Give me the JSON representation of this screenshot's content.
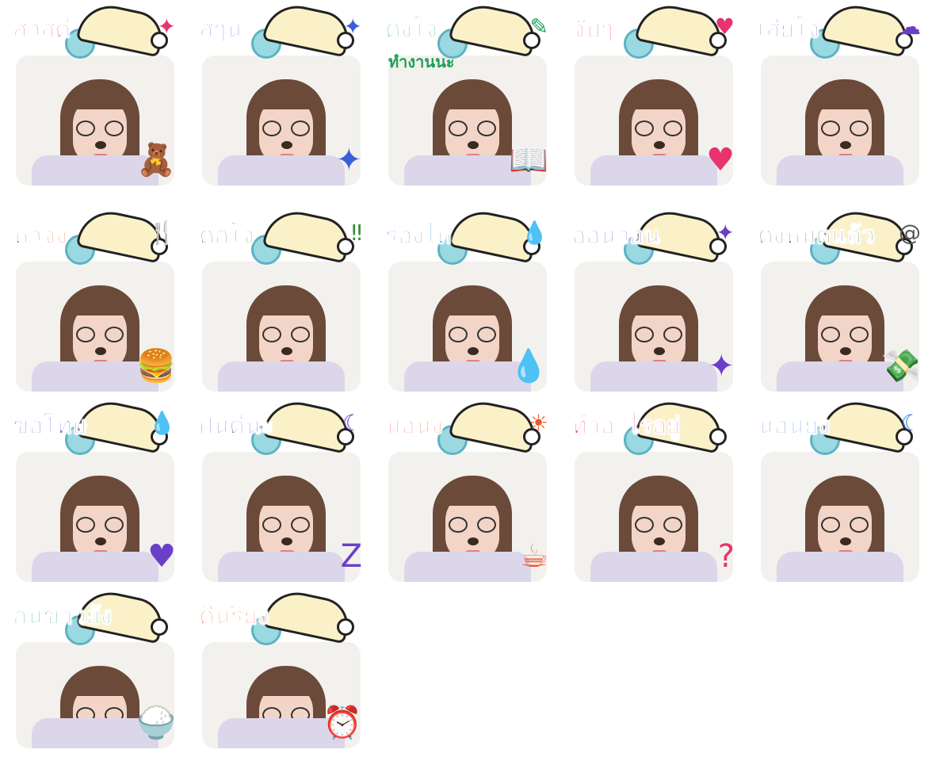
{
  "stickers": [
    {
      "label": "สวัสดี",
      "color": "#e8336f",
      "prop_icon": "teddy-bear",
      "prop": "🧸",
      "deco_icon": "sparkle",
      "deco": "✦"
    },
    {
      "label": "สู้ๆนะ",
      "color": "#3a5fd9",
      "prop_icon": "sparkle",
      "prop": "✦",
      "deco_icon": "sparkle",
      "deco": "✦"
    },
    {
      "label": "ตั้งใจ",
      "sublabel": "ทำงานนะ",
      "color": "#20a058",
      "prop_icon": "open-book",
      "prop": "📖",
      "deco_icon": "pen",
      "deco": "✎"
    },
    {
      "label": "จุ๊บๆ",
      "color": "#e8336f",
      "prop_icon": "heart",
      "prop": "♥",
      "deco_icon": "heart",
      "deco": "♥"
    },
    {
      "label": "เสียใจ",
      "color": "#6a3fc8",
      "prop_icon": "none",
      "prop": "",
      "deco_icon": "rain-cloud",
      "deco": "☁"
    },
    {
      "label": "หิวจัง",
      "color": "#f0572e",
      "prop_icon": "burger",
      "prop": "🍔",
      "deco_icon": "fork",
      "deco": "🍴"
    },
    {
      "label": "ตกใจ",
      "color": "#3a8c3a",
      "prop_icon": "burst",
      "prop": "",
      "deco_icon": "exclamation",
      "deco": "‼"
    },
    {
      "label": "ร้องไห้",
      "color": "#2f7ad8",
      "prop_icon": "teardrop",
      "prop": "💧",
      "deco_icon": "teardrop",
      "deco": "💧"
    },
    {
      "label": "อ้อนวอน",
      "color": "#6a3fc8",
      "prop_icon": "sparkle",
      "prop": "✦",
      "deco_icon": "sparkle",
      "deco": "✦"
    },
    {
      "label": "ตังหมดแล้ว",
      "color": "#555555",
      "prop_icon": "flying-money",
      "prop": "💸",
      "deco_icon": "scribble",
      "deco": "@"
    },
    {
      "label": "ขอโทษ",
      "color": "#6a3fc8",
      "prop_icon": "heart",
      "prop": "♥",
      "deco_icon": "sweat-drop",
      "deco": "💧"
    },
    {
      "label": "ฝันดีนะ",
      "color": "#6a3fc8",
      "prop_icon": "zzz",
      "prop": "Z",
      "deco_icon": "crescent-moon",
      "deco": "☾"
    },
    {
      "label": "มอนิ่ง",
      "color": "#f0572e",
      "prop_icon": "mug",
      "prop": "☕",
      "deco_icon": "sun",
      "deco": "☀"
    },
    {
      "label": "ทำอะไรอยู่",
      "color": "#e8336f",
      "prop_icon": "question-mark",
      "prop": "?",
      "deco_icon": "none",
      "deco": ""
    },
    {
      "label": "นอนยัง",
      "color": "#2f7ad8",
      "prop_icon": "pillow",
      "prop": "",
      "deco_icon": "crescent-moon",
      "deco": "☾"
    },
    {
      "label": "กินข้าวยัง",
      "color": "#20a058",
      "prop_icon": "rice-bowl",
      "prop": "🍚",
      "deco_icon": "none",
      "deco": ""
    },
    {
      "label": "ตื่นรึยัง",
      "color": "#f0572e",
      "prop_icon": "alarm-clock",
      "prop": "⏰",
      "deco_icon": "none",
      "deco": ""
    }
  ]
}
